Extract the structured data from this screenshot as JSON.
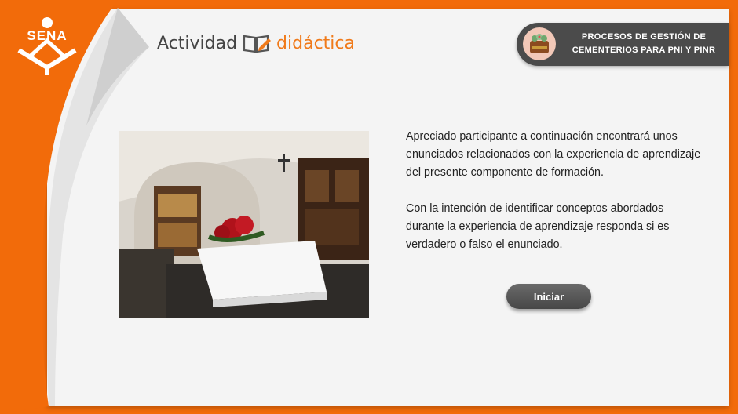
{
  "brand": {
    "logo_text": "SENA"
  },
  "header": {
    "title_part1": "Actividad",
    "title_part2": "didáctica",
    "course_line1": "PROCESOS DE GESTIÓN DE",
    "course_line2": "CEMENTERIOS PARA PNI Y PINR"
  },
  "main": {
    "paragraph1": "Apreciado participante a continuación encontrará unos enunciados relacionados con la experiencia de aprendizaje del presente componente de formación.",
    "paragraph2": "Con la intención de identificar conceptos abordados durante la experiencia de aprendizaje responda si es verdadero o falso el enunciado.",
    "start_button": "Iniciar"
  },
  "colors": {
    "accent": "#f26b0a",
    "badge_bg": "#4b4b4b",
    "button_bg": "#555555"
  }
}
